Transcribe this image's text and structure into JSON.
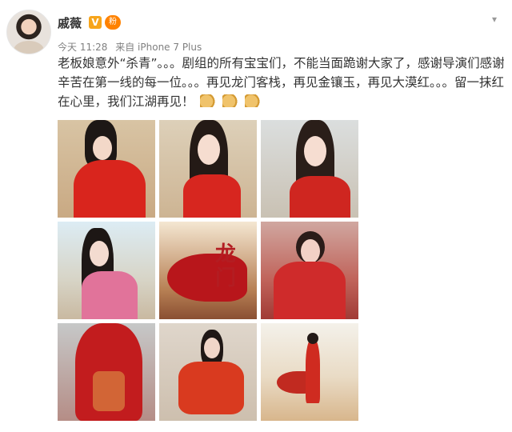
{
  "post": {
    "username": "戚薇",
    "vip_badge": "V",
    "fan_badge": "粉",
    "more_icon": "chevron-down-icon",
    "time": "今天 11:28",
    "source": "来自 iPhone 7 Plus",
    "text": "老板娘意外“杀青”。。。剧组的所有宝宝们，不能当面跪谢大家了，感谢导演们感谢辛苦在第一线的每一位。。。再见龙门客栈，再见金镶玉，再见大漠红。。。留一抹红在心里，我们江湖再见！",
    "text_emojis": [
      "praying-hands-icon",
      "praying-hands-icon",
      "praying-hands-icon"
    ],
    "photos": [
      {
        "subject": "woman in red dress with hair ornaments, desert background"
      },
      {
        "subject": "woman in red dress, long black hair, close-up"
      },
      {
        "subject": "woman in red dress, long hair, sand dunes"
      },
      {
        "subject": "woman in pink dress, side profile, sky background"
      },
      {
        "subject": "woman with flowing red cape on horse, poster with calligraphy"
      },
      {
        "subject": "woman in red wedding dress with crowd"
      },
      {
        "subject": "red veil and embroidered robe"
      },
      {
        "subject": "woman in red dress seated on sand"
      },
      {
        "subject": "woman in red dress on desert dunes"
      }
    ]
  },
  "colors": {
    "text": "#333333",
    "meta": "#808080",
    "vip": "#f7a51b",
    "fan": "#ff8200",
    "accent_red": "#d7261f"
  }
}
